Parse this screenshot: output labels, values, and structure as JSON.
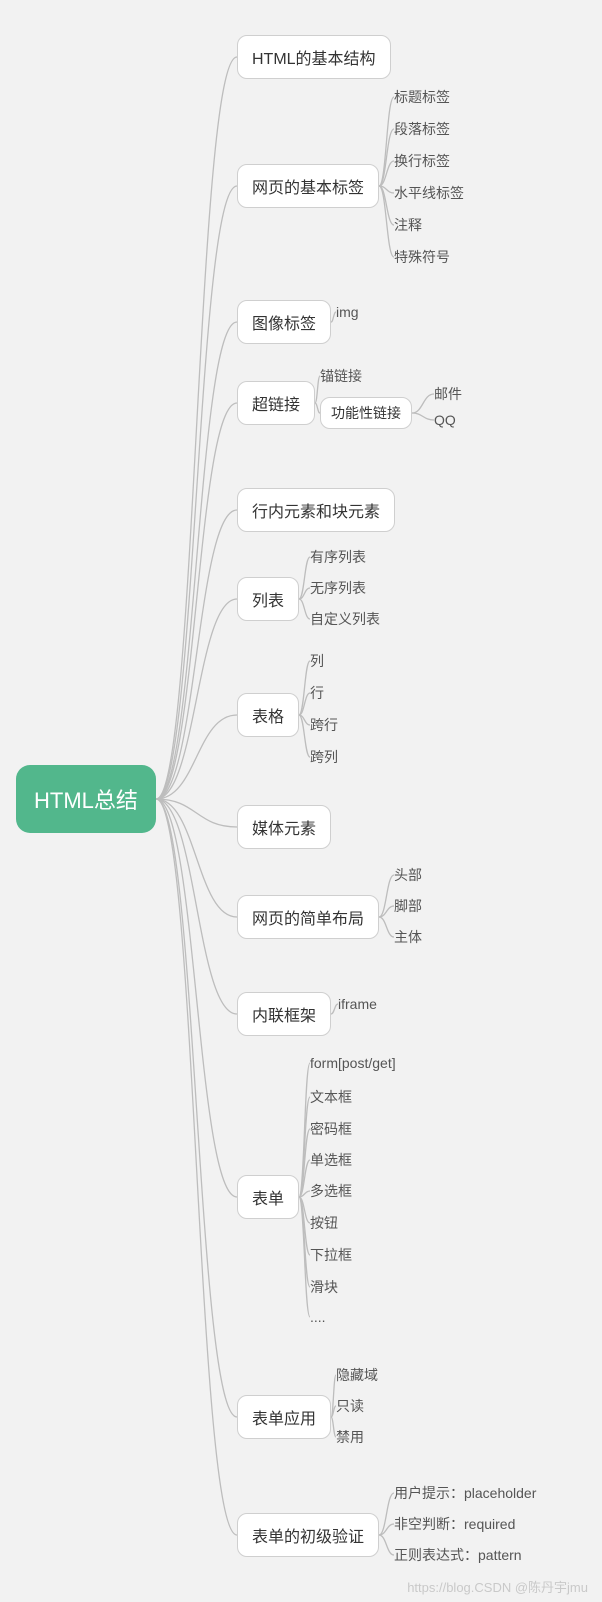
{
  "root": "HTML总结",
  "branches": [
    {
      "title": "HTML的基本结构",
      "children": []
    },
    {
      "title": "网页的基本标签",
      "children": [
        {
          "label": "标题标签"
        },
        {
          "label": "段落标签"
        },
        {
          "label": "换行标签"
        },
        {
          "label": "水平线标签"
        },
        {
          "label": "注释"
        },
        {
          "label": "特殊符号"
        }
      ]
    },
    {
      "title": "图像标签",
      "children": [
        {
          "label": "img"
        }
      ]
    },
    {
      "title": "超链接",
      "children": [
        {
          "label": "锚链接"
        },
        {
          "label": "功能性链接",
          "children": [
            {
              "label": "邮件"
            },
            {
              "label": "QQ"
            }
          ]
        }
      ]
    },
    {
      "title": "行内元素和块元素",
      "children": []
    },
    {
      "title": "列表",
      "children": [
        {
          "label": "有序列表"
        },
        {
          "label": "无序列表"
        },
        {
          "label": "自定义列表"
        }
      ]
    },
    {
      "title": "表格",
      "children": [
        {
          "label": "列"
        },
        {
          "label": "行"
        },
        {
          "label": "跨行"
        },
        {
          "label": "跨列"
        }
      ]
    },
    {
      "title": "媒体元素",
      "children": []
    },
    {
      "title": "网页的简单布局",
      "children": [
        {
          "label": "头部"
        },
        {
          "label": "脚部"
        },
        {
          "label": "主体"
        }
      ]
    },
    {
      "title": "内联框架",
      "children": [
        {
          "label": "iframe"
        }
      ]
    },
    {
      "title": "表单",
      "children": [
        {
          "label": "form[post/get]"
        },
        {
          "label": "文本框"
        },
        {
          "label": "密码框"
        },
        {
          "label": "单选框"
        },
        {
          "label": "多选框"
        },
        {
          "label": "按钮"
        },
        {
          "label": "下拉框"
        },
        {
          "label": "滑块"
        },
        {
          "label": "...."
        }
      ]
    },
    {
      "title": "表单应用",
      "children": [
        {
          "label": "隐藏域"
        },
        {
          "label": "只读"
        },
        {
          "label": "禁用"
        }
      ]
    },
    {
      "title": "表单的初级验证",
      "children": [
        {
          "label": "用户提示：placeholder"
        },
        {
          "label": "非空判断：required"
        },
        {
          "label": "正则表达式：pattern"
        }
      ]
    }
  ],
  "watermark": "https://blog.CSDN @陈丹宇jmu"
}
